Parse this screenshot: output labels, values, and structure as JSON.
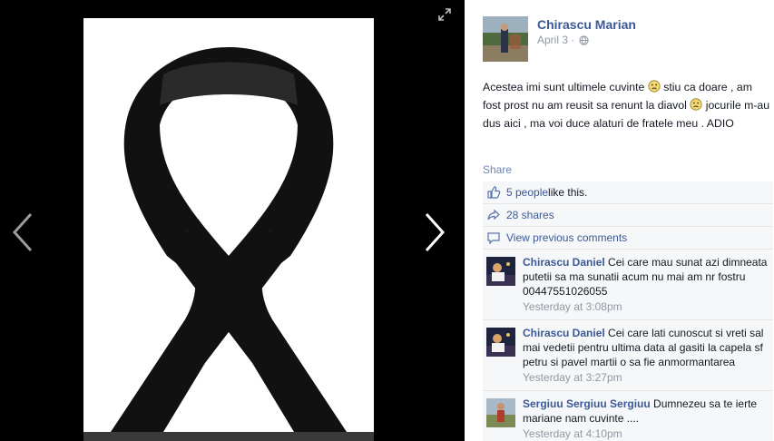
{
  "post": {
    "author": "Chirascu Marian",
    "date": "April 3",
    "separator": "·",
    "text_parts": [
      "Acestea imi sunt ultimele cuvinte ",
      " stiu ca doare , am fost prost nu am reusit sa renunt la diavol ",
      " jocurile m-au dus aici , ma voi duce alaturi de fratele meu . ADIO"
    ],
    "emoji": "frown-emoji",
    "share_label": "Share"
  },
  "ufi": {
    "likes_link": "5 people",
    "likes_suffix": " like this.",
    "shares": "28 shares",
    "view_previous": "View previous comments"
  },
  "comments": [
    {
      "author": "Chirascu Daniel",
      "text": "Cei care mau sunat azi dimneata putetii sa ma sunatii acum nu mai am nr fostru 00447551026055",
      "time": "Yesterday at 3:08pm"
    },
    {
      "author": "Chirascu Daniel",
      "text": "Cei care lati cunoscut si vreti sal mai vedetii pentru ultima data al gasiti la capela sf petru si pavel martii o sa fie anmormantarea",
      "time": "Yesterday at 3:27pm"
    },
    {
      "author": "Sergiuu Sergiuu Sergiuu",
      "text": "Dumnezeu sa te ierte mariane nam cuvinte ....",
      "time": "Yesterday at 4:10pm"
    }
  ],
  "icons": {
    "expand": "expand-icon",
    "prev": "chevron-left-icon",
    "next": "chevron-right-icon",
    "globe": "globe-icon",
    "like": "thumbs-up-icon",
    "share": "share-arrow-icon",
    "comment": "comment-bubble-icon"
  },
  "colors": {
    "link": "#3b5998",
    "meta": "#9197a3",
    "ufi_bg": "#f6f7f8",
    "stage_bg": "#000000",
    "ribbon": "#111111"
  }
}
